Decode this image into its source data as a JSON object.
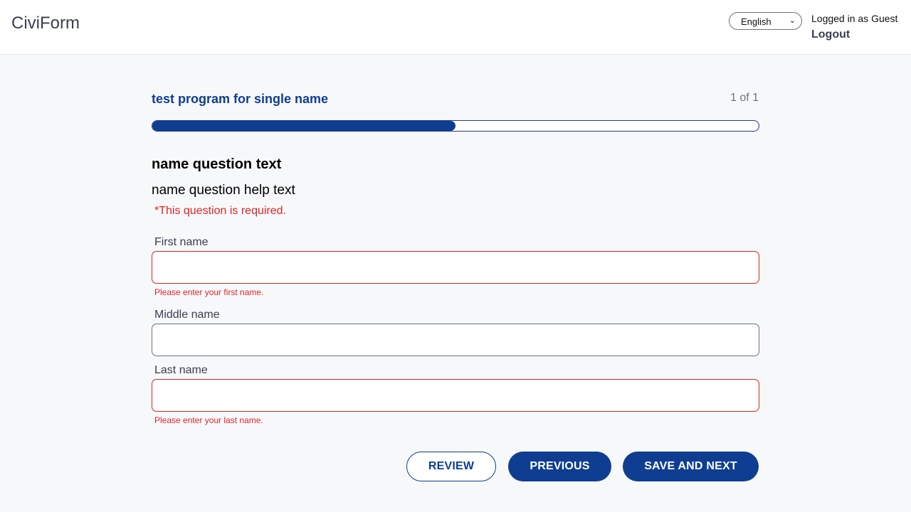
{
  "header": {
    "brand": "CiviForm",
    "language": "English",
    "user_status": "Logged in as Guest",
    "logout_label": "Logout"
  },
  "program": {
    "title": "test program for single name",
    "page_count": "1 of 1",
    "progress_percent": 50
  },
  "question": {
    "text": "name question text",
    "help_text": "name question help text",
    "required_notice": "*This question is required."
  },
  "fields": {
    "first": {
      "label": "First name",
      "value": "",
      "error": "Please enter your first name."
    },
    "middle": {
      "label": "Middle name",
      "value": ""
    },
    "last": {
      "label": "Last name",
      "value": "",
      "error": "Please enter your last name."
    }
  },
  "actions": {
    "review": "REVIEW",
    "previous": "PREVIOUS",
    "save_next": "SAVE AND NEXT"
  },
  "colors": {
    "primary": "#0f3d91",
    "error": "#dc2626"
  }
}
